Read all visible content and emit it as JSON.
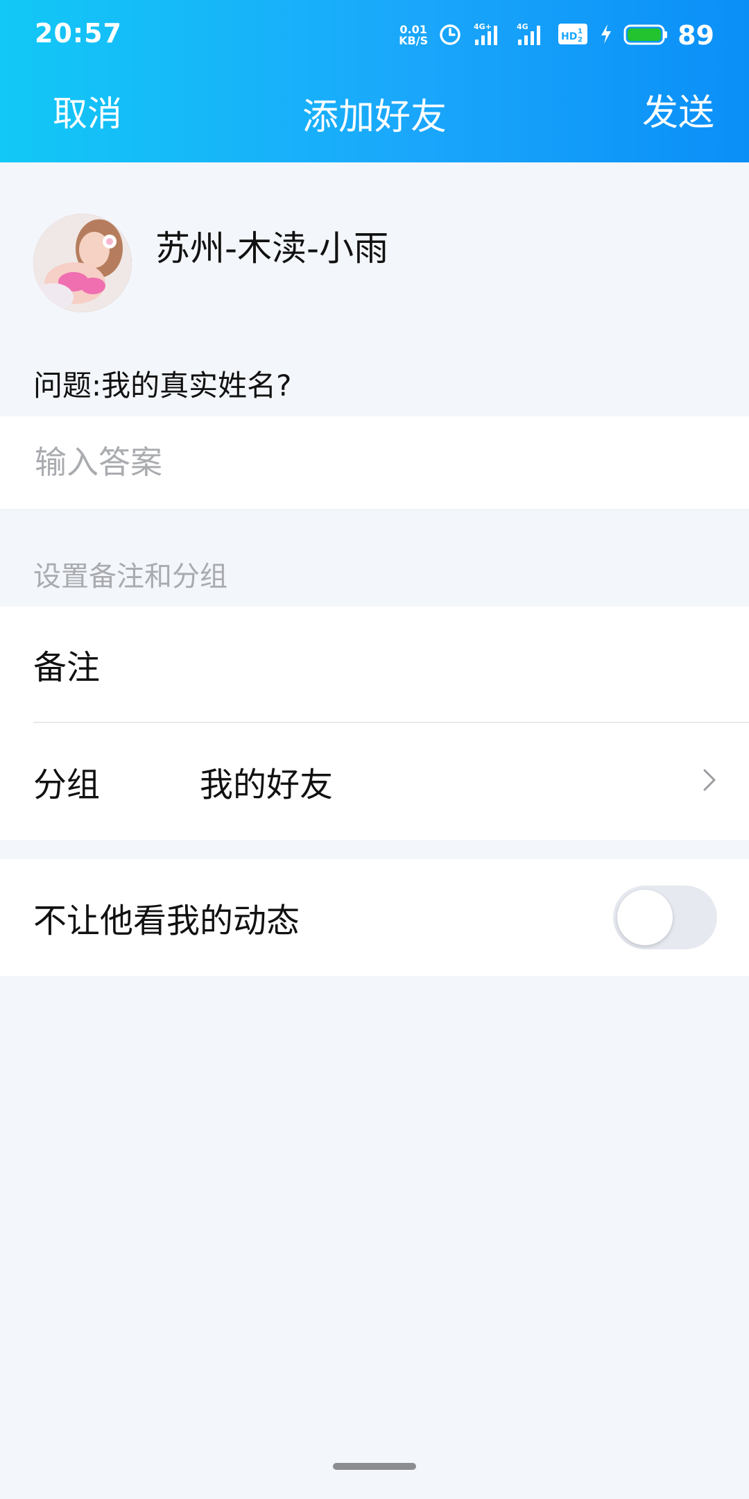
{
  "status_bar": {
    "time": "20:57",
    "net_speed_value": "0.01",
    "net_speed_unit": "KB/S",
    "signal_1_label": "4G+",
    "signal_2_label": "4G",
    "hd_label": "HD",
    "battery_level": "89",
    "icons": [
      "alarm-icon",
      "signal-icon",
      "signal-icon",
      "hd-voice-icon",
      "charging-icon",
      "battery-icon"
    ],
    "battery_color": "#22c32e"
  },
  "nav": {
    "cancel_label": "取消",
    "title": "添加好友",
    "send_label": "发送"
  },
  "profile": {
    "name": "苏州-木渎-小雨"
  },
  "question": {
    "text": "问题:我的真实姓名?"
  },
  "answer": {
    "placeholder": "输入答案",
    "value": ""
  },
  "settings": {
    "section_label": "设置备注和分组",
    "remark_label": "备注",
    "group_label": "分组",
    "group_value": "我的好友"
  },
  "privacy": {
    "toggle_label": "不让他看我的动态",
    "toggle_on": false
  },
  "colors": {
    "header_start": "#12c8f6",
    "header_end": "#0a8ff7",
    "background": "#f3f6fa",
    "placeholder": "#a9abaf"
  }
}
